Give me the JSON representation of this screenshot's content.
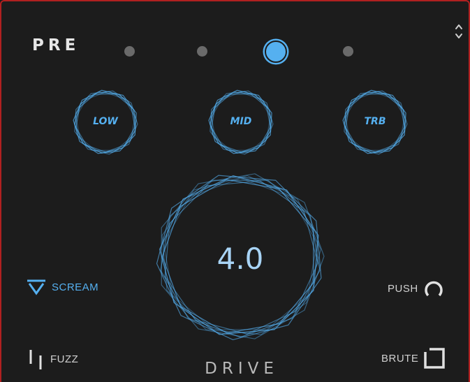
{
  "colors": {
    "accent": "#55b0f0",
    "background": "#1c1c1c",
    "frame": "#b02020",
    "text": "#d0d0d0",
    "dot": "#6a6a6a"
  },
  "header": {
    "section_label": "PRE",
    "preset_dots": [
      {
        "active": false
      },
      {
        "active": false
      },
      {
        "active": true
      },
      {
        "active": false
      }
    ],
    "menu_icon": "up-down-chevron-icon"
  },
  "tone_knobs": [
    {
      "label": "LOW"
    },
    {
      "label": "MID"
    },
    {
      "label": "TRB"
    }
  ],
  "drive": {
    "value": "4.0",
    "label": "DRIVE"
  },
  "modes": {
    "scream": {
      "label": "SCREAM",
      "icon": "inverted-triangle-icon",
      "active": true
    },
    "push": {
      "label": "PUSH",
      "icon": "open-circle-icon",
      "active": false
    },
    "fuzz": {
      "label": "FUZZ",
      "icon": "offset-bars-icon",
      "active": false
    },
    "brute": {
      "label": "BRUTE",
      "icon": "open-square-icon",
      "active": false
    }
  }
}
